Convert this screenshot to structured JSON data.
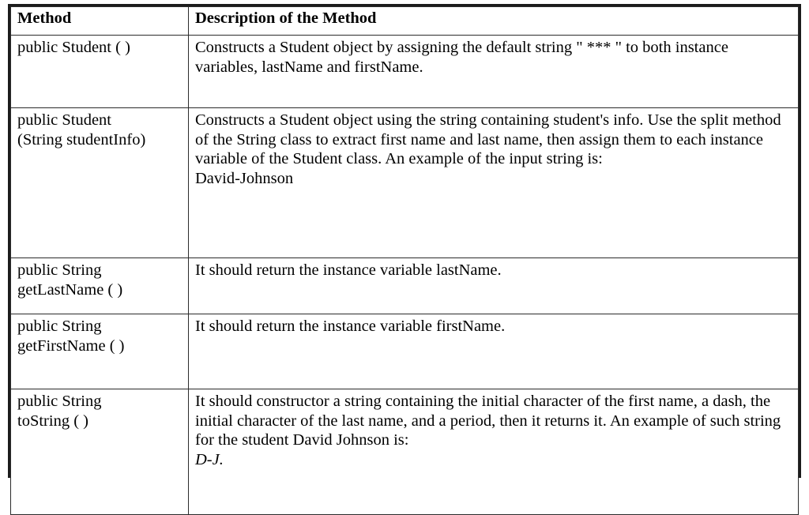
{
  "table": {
    "headers": {
      "method": "Method",
      "description": "Description of the Method"
    },
    "rows": [
      {
        "method": "public Student ( )",
        "description": "Constructs a Student object by assigning the default string \" *** \" to both instance variables, lastName and firstName.",
        "description_italic": ""
      },
      {
        "method": "public Student\n(String studentInfo)",
        "description": "Constructs a Student object using the string containing student's info. Use the split method of the String class to extract first name and last name, then assign them to each instance variable of the Student class. An example of the input string is:\nDavid-Johnson",
        "description_italic": ""
      },
      {
        "method": "public String\ngetLastName ( )",
        "description": "It should return the instance variable lastName.",
        "description_italic": ""
      },
      {
        "method": "public String\ngetFirstName ( )",
        "description": "It should return the instance variable firstName.",
        "description_italic": ""
      },
      {
        "method": "public String\ntoString ( )",
        "description": "It should constructor a string containing the initial character of the first name, a dash, the initial character of the last name, and a period, then it returns it.  An example of such string for the student David Johnson is:",
        "description_italic": "D-J."
      }
    ]
  },
  "style": {
    "border_color": "#1c1c1c",
    "inner_border_color": "#2b2b2b",
    "text_color": "#000000",
    "background": "#ffffff"
  }
}
